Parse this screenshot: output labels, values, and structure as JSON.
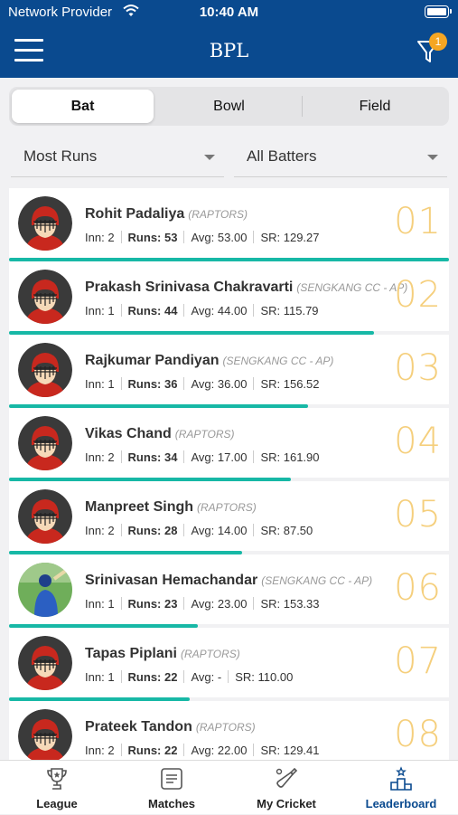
{
  "status_bar": {
    "carrier": "Network Provider",
    "time": "10:40 AM"
  },
  "nav": {
    "title": "BPL",
    "filter_badge": "1"
  },
  "segment": {
    "tabs": [
      "Bat",
      "Bowl",
      "Field"
    ],
    "selected": "Bat"
  },
  "filters": {
    "sort": "Most Runs",
    "scope": "All Batters"
  },
  "leaderboard": [
    {
      "rank": "01",
      "name": "Rohit Padaliya",
      "team": "(RAPTORS)",
      "inn": "2",
      "runs": "53",
      "avg": "53.00",
      "sr": "129.27",
      "progress": 1.0,
      "avatar": "helmet-avatar"
    },
    {
      "rank": "02",
      "name": "Prakash Srinivasa Chakravarti",
      "team": "(SENGKANG CC - AP)",
      "inn": "1",
      "runs": "44",
      "avg": "44.00",
      "sr": "115.79",
      "progress": 0.83,
      "avatar": "helmet-avatar"
    },
    {
      "rank": "03",
      "name": "Rajkumar Pandiyan",
      "team": "(SENGKANG CC - AP)",
      "inn": "1",
      "runs": "36",
      "avg": "36.00",
      "sr": "156.52",
      "progress": 0.68,
      "avatar": "helmet-avatar"
    },
    {
      "rank": "04",
      "name": "Vikas Chand",
      "team": "(RAPTORS)",
      "inn": "2",
      "runs": "34",
      "avg": "17.00",
      "sr": "161.90",
      "progress": 0.64,
      "avatar": "helmet-avatar"
    },
    {
      "rank": "05",
      "name": "Manpreet Singh",
      "team": "(RAPTORS)",
      "inn": "2",
      "runs": "28",
      "avg": "14.00",
      "sr": "87.50",
      "progress": 0.53,
      "avatar": "helmet-avatar"
    },
    {
      "rank": "06",
      "name": "Srinivasan Hemachandar",
      "team": "(SENGKANG CC - AP)",
      "inn": "1",
      "runs": "23",
      "avg": "23.00",
      "sr": "153.33",
      "progress": 0.43,
      "avatar": "player-photo-avatar"
    },
    {
      "rank": "07",
      "name": "Tapas Piplani",
      "team": "(RAPTORS)",
      "inn": "1",
      "runs": "22",
      "avg": "-",
      "sr": "110.00",
      "progress": 0.41,
      "avatar": "helmet-avatar"
    },
    {
      "rank": "08",
      "name": "Prateek Tandon",
      "team": "(RAPTORS)",
      "inn": "2",
      "runs": "22",
      "avg": "22.00",
      "sr": "129.41",
      "progress": 0.41,
      "avatar": "helmet-avatar"
    }
  ],
  "stat_labels": {
    "inn": "Inn:",
    "runs": "Runs:",
    "avg": "Avg:",
    "sr": "SR:"
  },
  "tab_bar": [
    {
      "label": "League",
      "icon": "trophy-icon"
    },
    {
      "label": "Matches",
      "icon": "scorecard-icon"
    },
    {
      "label": "My Cricket",
      "icon": "cricket-bat-icon"
    },
    {
      "label": "Leaderboard",
      "icon": "podium-star-icon",
      "active": true
    }
  ],
  "colors": {
    "nav_bg": "#0a4a8f",
    "accent_teal": "#17b8a6",
    "rank_gold": "#f5cf7d",
    "badge_orange": "#f5a623"
  }
}
